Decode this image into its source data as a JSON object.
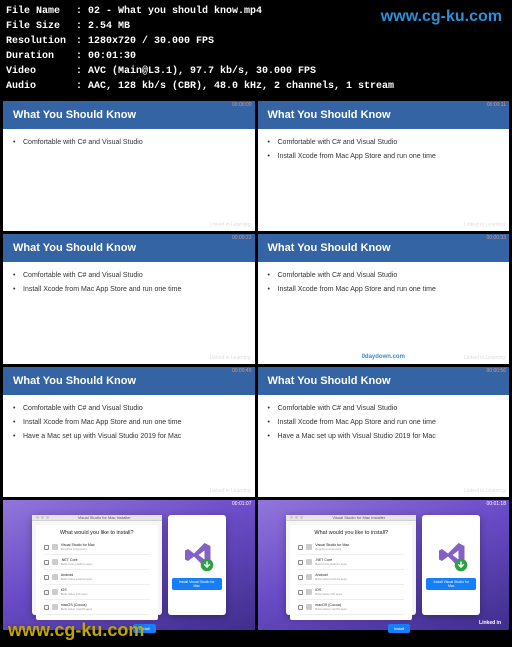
{
  "metadata": {
    "file_name_label": "File Name",
    "file_name": "02 - What you should know.mp4",
    "file_size_label": "File Size",
    "file_size": "2.54 MB",
    "resolution_label": "Resolution",
    "resolution": "1280x720 / 30.000 FPS",
    "duration_label": "Duration",
    "duration": "00:01:30",
    "video_label": "Video",
    "video": "AVC (Main@L3.1), 97.7 kb/s, 30.000 FPS",
    "audio_label": "Audio",
    "audio": "AAC, 128 kb/s (CBR), 48.0 kHz, 2 channels, 1 stream"
  },
  "watermark_top": "www.cg-ku.com",
  "watermark_bottom": "www.cg-ku.com",
  "slide_title": "What You Should Know",
  "slide_brand": "Linked in Learning",
  "bullets": {
    "b1": "Comfortable with C# and Visual Studio",
    "b2": "Install Xcode from Mac App Store and run one time",
    "b3": "Have a Mac set up with Visual Studio 2019 for Mac"
  },
  "timecodes": {
    "s1": "00:00:00",
    "s2": "00:00:11",
    "s3": "00:00:22",
    "s4": "00:00:33",
    "s5": "00:00:45",
    "s6": "00:00:56",
    "s7": "00:01:07",
    "s8": "00:01:18"
  },
  "center_watermark": "0daydown.com",
  "installer": {
    "window_title": "Visual Studio for Mac Installer",
    "heading": "What would you like to install?",
    "items": [
      {
        "name": "Visual Studio for Mac",
        "sub": "Required component"
      },
      {
        "name": ".NET Core",
        "sub": "Build cross-platform apps"
      },
      {
        "name": "Android",
        "sub": "Build native Android apps"
      },
      {
        "name": "iOS",
        "sub": "Build native iOS apps"
      },
      {
        "name": "macOS (Cocoa)",
        "sub": "Build native macOS apps"
      }
    ],
    "install_button": "Install",
    "panel_button": "Install Visual Studio for Mac"
  },
  "linkedin_text": "Linked in"
}
